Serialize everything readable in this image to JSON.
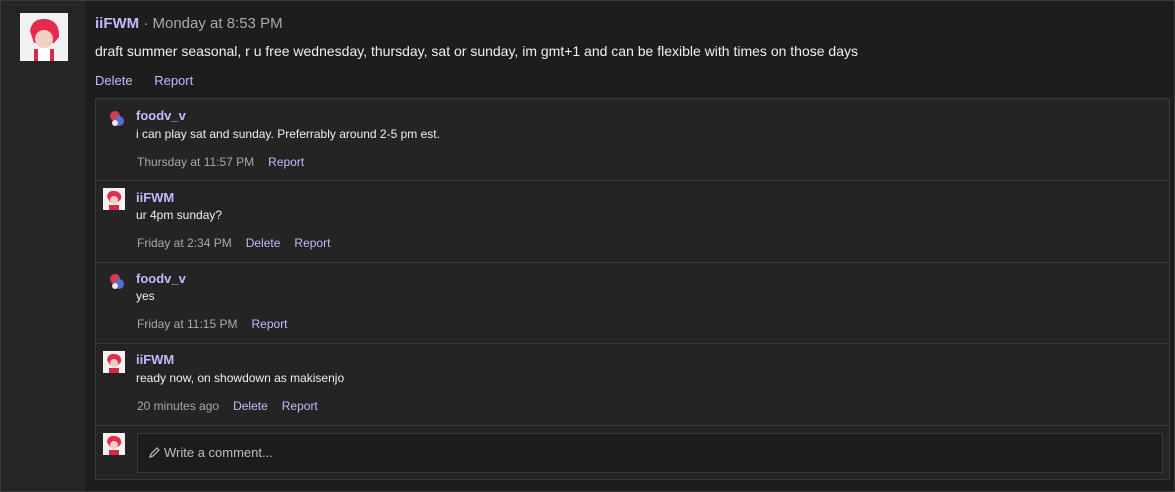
{
  "post": {
    "author": "iiFWM",
    "separator": " · ",
    "time": "Monday at 8:53 PM",
    "text": "draft summer seasonal, r u free wednesday, thursday, sat or sunday, im gmt+1 and can be flexible with times on those days",
    "actions": {
      "delete": "Delete",
      "report": "Report"
    }
  },
  "comments": [
    {
      "author": "foodv_v",
      "text": "i can play sat and sunday. Preferrably around 2-5 pm est.",
      "time": "Thursday at 11:57 PM",
      "report": "Report"
    },
    {
      "author": "iiFWM",
      "text": "ur 4pm sunday?",
      "time": "Friday at 2:34 PM",
      "delete": "Delete",
      "report": "Report"
    },
    {
      "author": "foodv_v",
      "text": "yes",
      "time": "Friday at 11:15 PM",
      "report": "Report"
    },
    {
      "author": "iiFWM",
      "text": "ready now, on showdown as makisenjo",
      "time": "20 minutes ago",
      "delete": "Delete",
      "report": "Report"
    }
  ],
  "composer": {
    "placeholder": "Write a comment..."
  },
  "colors": {
    "accent": "#c3b9ff",
    "background": "#1d1d1d"
  }
}
